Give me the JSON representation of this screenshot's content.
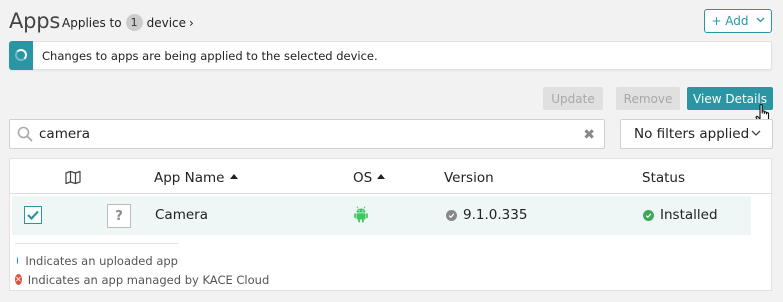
{
  "header": {
    "title": "Apps",
    "applies_prefix": "Applies to",
    "device_count": "1",
    "applies_suffix": "device",
    "add_label": "+ Add"
  },
  "notice": {
    "text": "Changes to apps are being applied to the selected device."
  },
  "actions": {
    "update": "Update",
    "remove": "Remove",
    "view_details": "View Details"
  },
  "search": {
    "value": "camera",
    "placeholder": ""
  },
  "filter": {
    "label": "No filters applied"
  },
  "table": {
    "columns": {
      "app_name": "App Name",
      "os": "OS",
      "version": "Version",
      "status": "Status"
    },
    "rows": [
      {
        "app_name": "Camera",
        "os_icon": "android-icon",
        "version": "9.1.0.335",
        "status": "Installed",
        "checked": true
      }
    ]
  },
  "legend": {
    "uploaded": "Indicates an uploaded app",
    "managed": "Indicates an app managed by KACE Cloud"
  },
  "colors": {
    "accent": "#2a95a3",
    "status_installed": "#3aaa5a",
    "android": "#3cc760",
    "managed": "#e0533c"
  }
}
